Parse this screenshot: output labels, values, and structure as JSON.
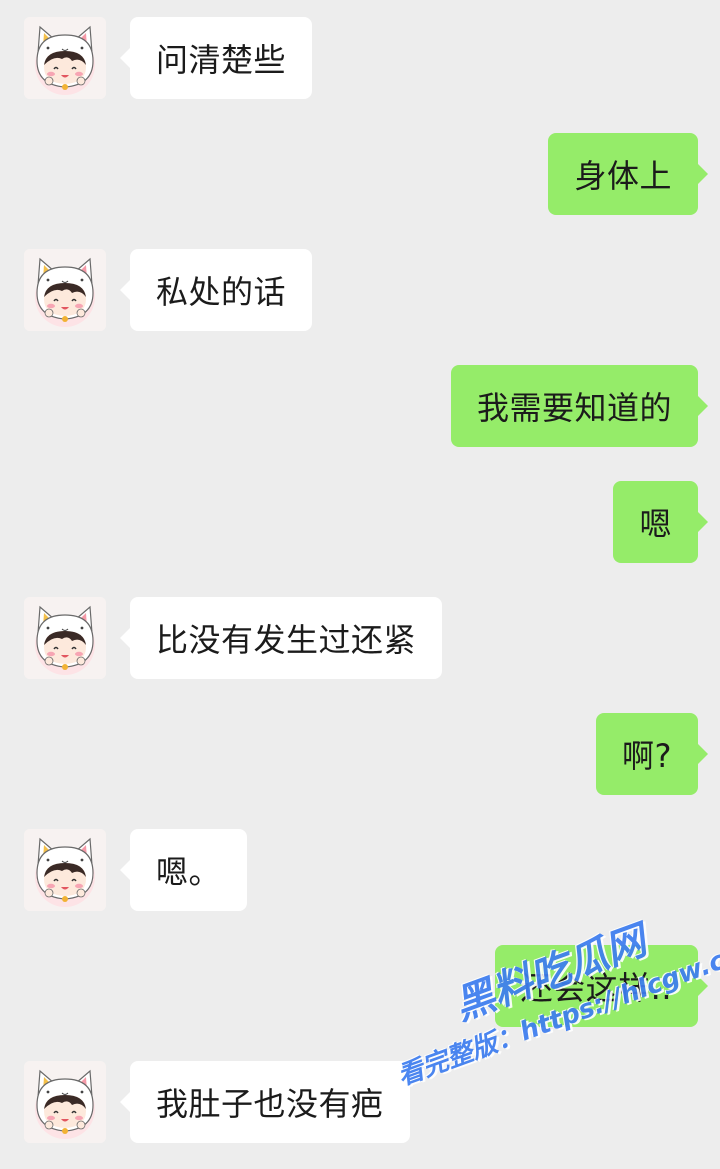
{
  "conversation": {
    "messages": [
      {
        "direction": "in",
        "text": "问清楚些"
      },
      {
        "direction": "out",
        "text": "身体上"
      },
      {
        "direction": "in",
        "text": "私处的话"
      },
      {
        "direction": "out",
        "text": "我需要知道的"
      },
      {
        "direction": "out",
        "text": "嗯"
      },
      {
        "direction": "in",
        "text": "比没有发生过还紧"
      },
      {
        "direction": "out",
        "text": "啊?"
      },
      {
        "direction": "in",
        "text": "嗯。"
      },
      {
        "direction": "out",
        "text": "还会这样.."
      },
      {
        "direction": "in",
        "text": "我肚子也没有疤"
      }
    ]
  },
  "watermark": {
    "brand": "黑料吃瓜网",
    "line": "看完整版：https://hlcgw.co"
  },
  "colors": {
    "background": "#ededed",
    "incoming_bubble": "#ffffff",
    "outgoing_bubble": "#95ec69",
    "watermark": "#3d7df0"
  }
}
